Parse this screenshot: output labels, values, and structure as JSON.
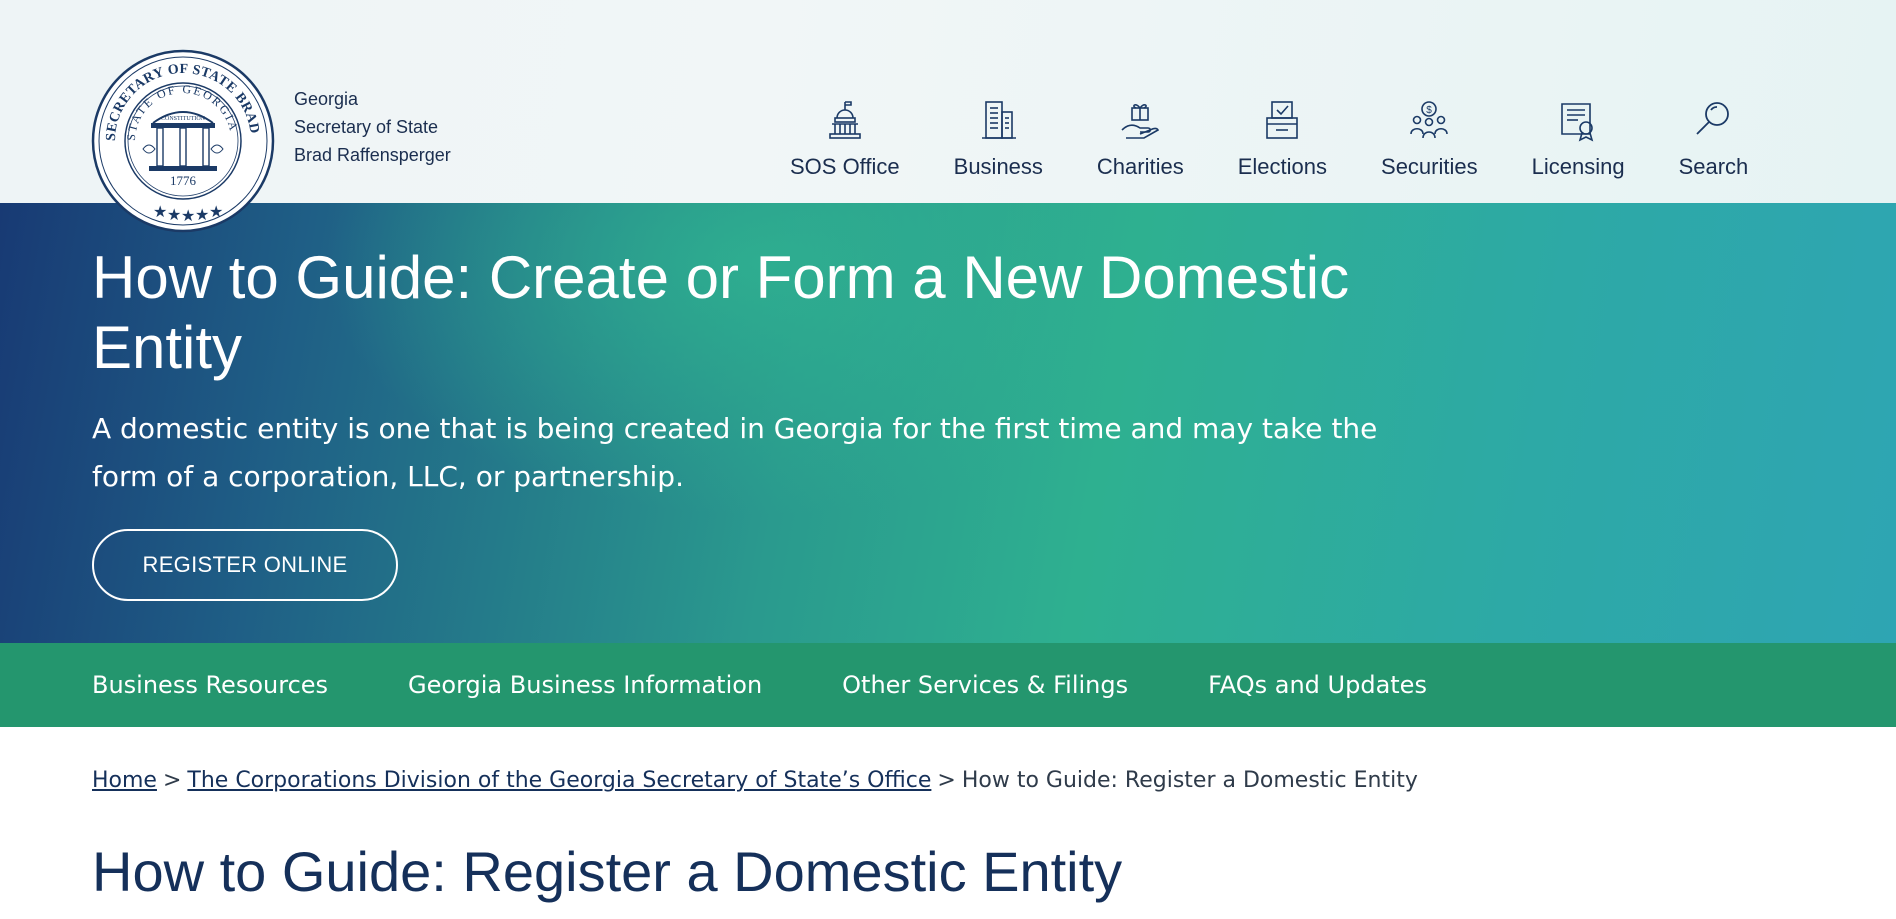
{
  "header": {
    "seal": {
      "outer_text": "SECRETARY OF STATE BRAD RAFFENSPERGER",
      "inner_text": "STATE OF GEORGIA",
      "constitution": "CONSTITUTION",
      "year": "1776"
    },
    "org_lines": [
      "Georgia",
      "Secretary of State",
      "Brad Raffensperger"
    ],
    "nav": [
      {
        "label": "SOS Office",
        "icon": "capitol-icon"
      },
      {
        "label": "Business",
        "icon": "building-icon"
      },
      {
        "label": "Charities",
        "icon": "gift-hand-icon"
      },
      {
        "label": "Elections",
        "icon": "ballot-box-icon"
      },
      {
        "label": "Securities",
        "icon": "people-dollar-icon"
      },
      {
        "label": "Licensing",
        "icon": "certificate-icon"
      },
      {
        "label": "Search",
        "icon": "search-icon"
      }
    ]
  },
  "hero": {
    "title": "How to Guide: Create or Form a New Domestic Entity",
    "description": "A domestic entity is one that is being created in Georgia for the first time and may take the form of a corporation, LLC, or partnership.",
    "button_label": "REGISTER ONLINE"
  },
  "subnav": [
    "Business Resources",
    "Georgia Business Information",
    "Other Services & Filings",
    "FAQs and Updates"
  ],
  "breadcrumb": {
    "links": [
      "Home",
      "The Corporations Division of the Georgia Secretary of State’s Office"
    ],
    "separator": ">",
    "current": "How to Guide: Register a Domestic Entity"
  },
  "page_title": "How to Guide: Register a Domestic Entity",
  "colors": {
    "navy": "#15305a",
    "teal": "#2eb090",
    "green_bar": "#24966e"
  }
}
